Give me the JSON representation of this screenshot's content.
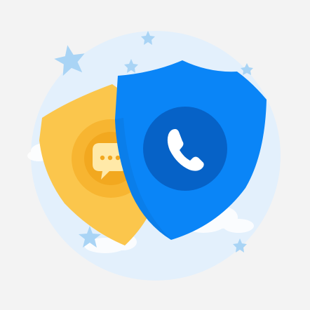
{
  "illustration": {
    "colors": {
      "page_background": "#f3f3f3",
      "circle_background": "#e3f0fc",
      "circle_inner_glow": "#d8eafa",
      "cloud": "#ffffff",
      "star": "#a9d4f5",
      "yellow_shield": "#fbc64c",
      "yellow_shield_shade": "#f6b533",
      "yellow_badge_outer": "#f7b531",
      "yellow_badge_inner": "#f2a81f",
      "chat_bubble": "#ffe9a8",
      "chat_dots": "#f2a81f",
      "blue_shield": "#0a85f7",
      "blue_shield_edge": "#0b78e0",
      "blue_badge": "#0662c7",
      "phone": "#ffffff"
    },
    "icons": {
      "chat": "chat-bubble-icon",
      "phone": "phone-handset-icon",
      "star": "star-icon",
      "shield": "shield-icon",
      "cloud": "cloud-icon"
    }
  }
}
